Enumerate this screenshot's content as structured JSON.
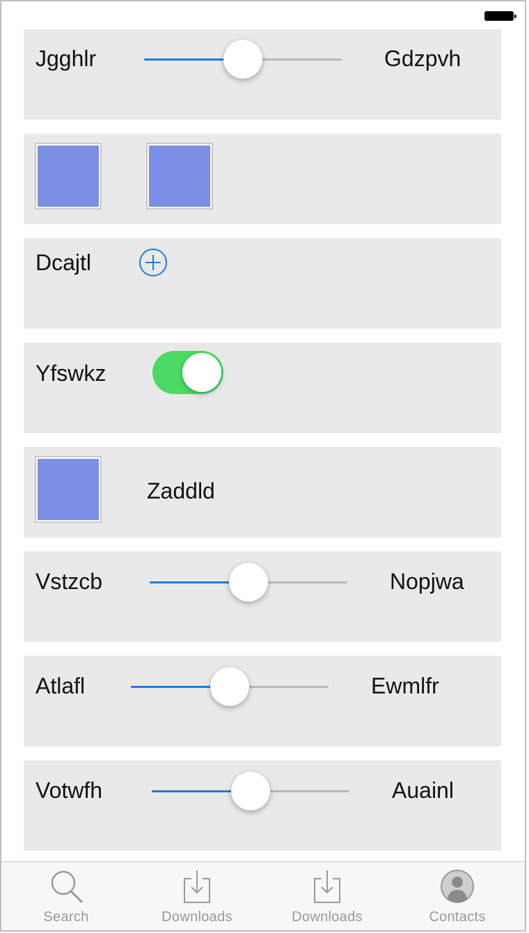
{
  "status_bar": {
    "battery_icon": "battery-full-icon"
  },
  "rows": {
    "r1": {
      "left_label": "Jgghlr",
      "right_label": "Gdzpvh",
      "slider_value": 0.5
    },
    "r2": {
      "accent": "#7b8fe6"
    },
    "r3": {
      "label": "Dcajtl",
      "add_icon": "plus-circle-icon"
    },
    "r4": {
      "label": "Yfswkz",
      "toggle_on": true,
      "toggle_color": "#4cd964"
    },
    "r5": {
      "label": "Zaddld",
      "accent": "#7b8fe6"
    },
    "r6": {
      "left_label": "Vstzcb",
      "right_label": "Nopjwa",
      "slider_value": 0.5
    },
    "r7": {
      "left_label": "Atlafl",
      "right_label": "Ewmlfr",
      "slider_value": 0.5
    },
    "r8": {
      "left_label": "Votwfh",
      "right_label": "Auainl",
      "slider_value": 0.5
    }
  },
  "tabbar": {
    "tabs": [
      {
        "label": "Search",
        "icon": "search-icon"
      },
      {
        "label": "Downloads",
        "icon": "download-icon"
      },
      {
        "label": "Downloads",
        "icon": "download-icon"
      },
      {
        "label": "Contacts",
        "icon": "contact-icon"
      }
    ]
  },
  "colors": {
    "slider_fill": "#1f7ae0",
    "slider_track": "#b9b9b9",
    "row_bg": "#e9e9e9"
  }
}
